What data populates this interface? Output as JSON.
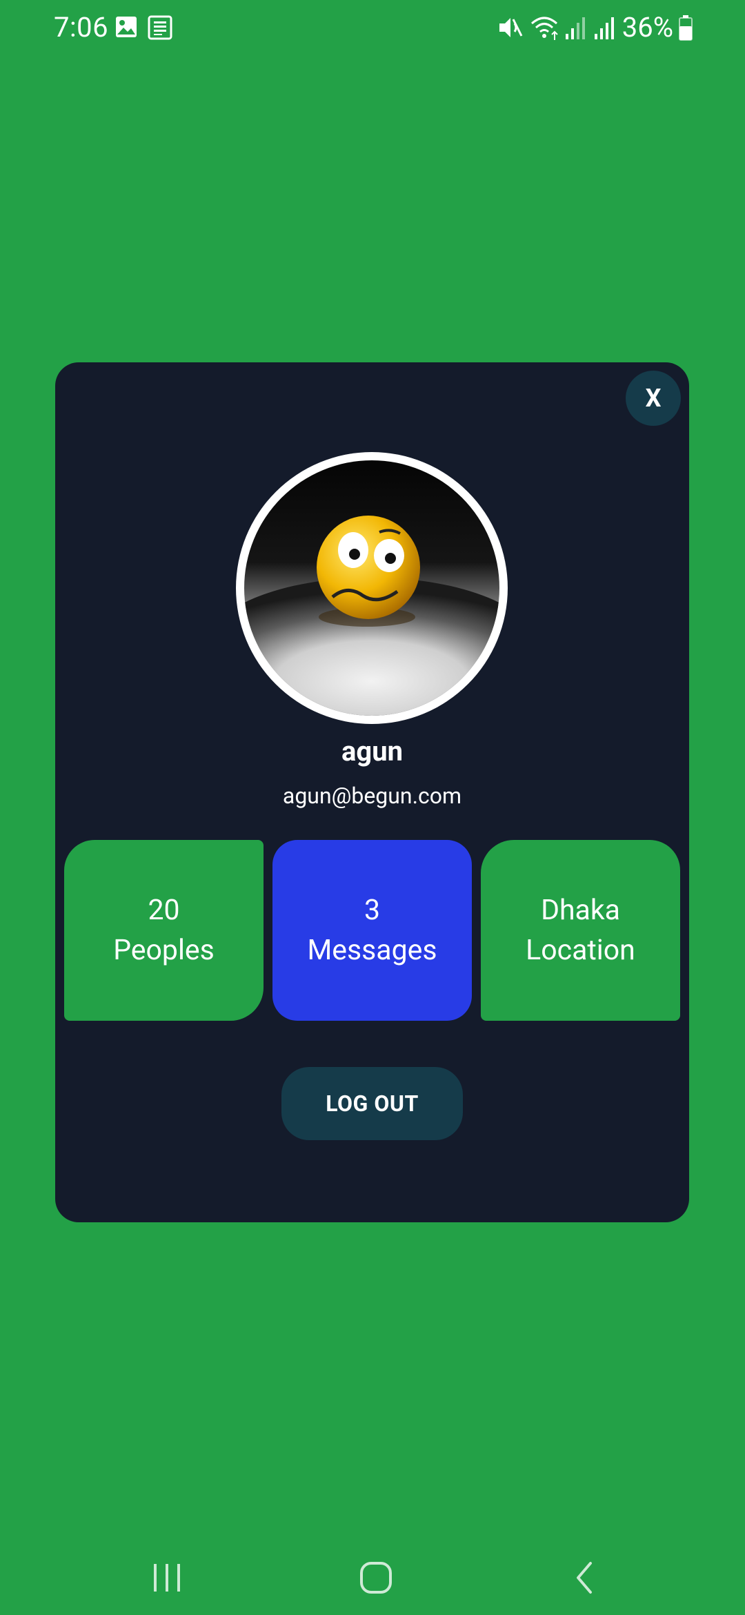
{
  "status_bar": {
    "time": "7:06",
    "battery": "36%",
    "icons": [
      "image-icon",
      "news-icon",
      "mute-icon",
      "wifi-icon",
      "signal-icon",
      "signal-icon-2",
      "battery-icon"
    ]
  },
  "profile_card": {
    "close_label": "X",
    "name": "agun",
    "email": "agun@begun.com",
    "stats": {
      "people": {
        "value": "20",
        "label": "Peoples"
      },
      "messages": {
        "value": "3",
        "label": "Messages"
      },
      "location": {
        "value": "Dhaka",
        "label": "Location"
      }
    },
    "logout_label": "LOG OUT"
  },
  "nav_bar": {
    "icons": [
      "recent-apps-icon",
      "home-icon",
      "back-icon"
    ]
  },
  "colors": {
    "background": "#23a147",
    "card": "#141b2b",
    "accent_dark_teal": "#153b4a",
    "messages_blue": "#283ce6",
    "tile_green": "#23a147"
  }
}
